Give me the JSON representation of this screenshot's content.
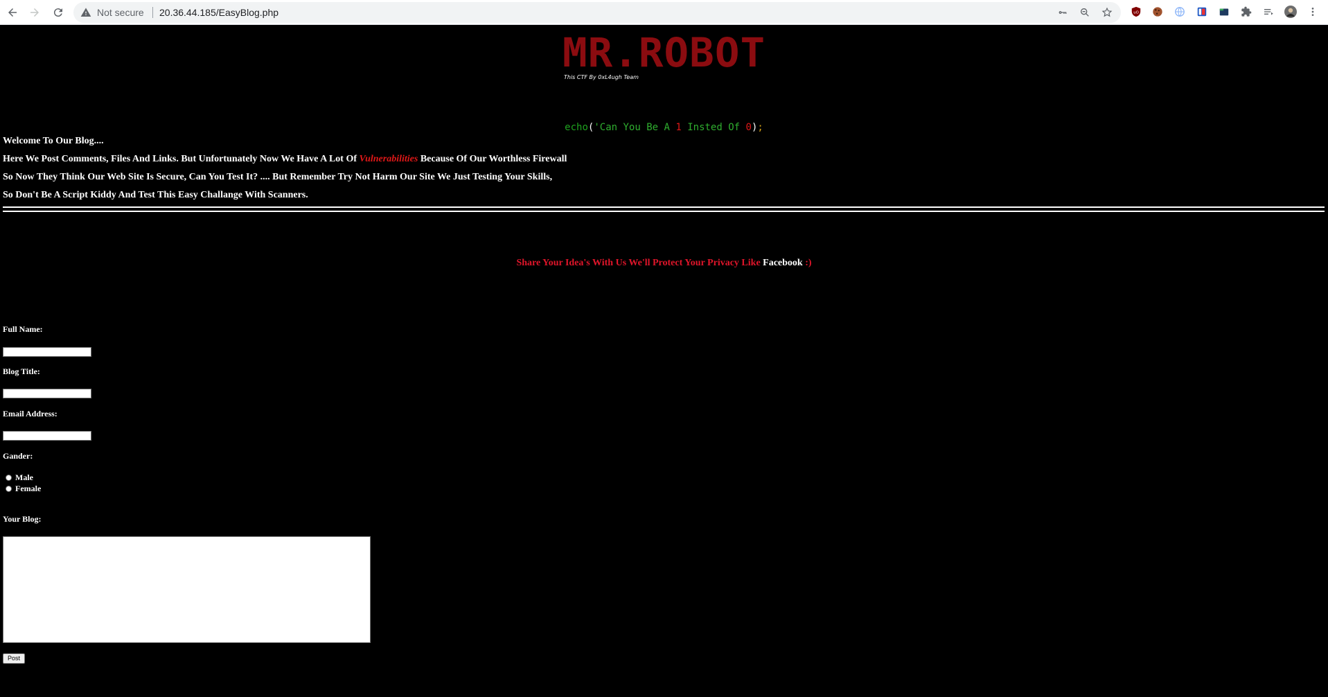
{
  "browser": {
    "security_label": "Not secure",
    "url": "20.36.44.185/EasyBlog.php"
  },
  "logo": {
    "title": "MR.ROBOT",
    "subtitle": "This CTF By 0xL4ugh Team",
    "color": "#8b0c10"
  },
  "echo_line": {
    "keyword": "echo",
    "open": "(",
    "quote_open": "'",
    "text_1": "Can You Be A ",
    "one": "1",
    "text_2": " Insted Of ",
    "zero": "0",
    "close": ")",
    "semicolon": ";"
  },
  "intro": {
    "line1": "Welcome To Our Blog....",
    "line2_pre": "Here We Post Comments, Files And Links. But Unfortunately Now We Have A Lot Of ",
    "line2_highlight": "Vulnerabilities",
    "line2_post": " Because Of Our Worthless Firewall",
    "line3": "So Now They Think Our Web Site Is Secure, Can You Test It? .... But Remember Try Not Harm Our Site We Just Testing Your Skills,",
    "line4": "So Don't Be A Script Kiddy And Test This Easy Challange With Scanners."
  },
  "share": {
    "text": "Share Your Idea's With Us We'll Protect Your Privacy Like ",
    "brand": "Facebook",
    "smile": " :)"
  },
  "form": {
    "full_name_label": "Full Name:",
    "full_name_value": "",
    "blog_title_label": "Blog Title:",
    "blog_title_value": "",
    "email_label": "Email Address:",
    "email_value": "",
    "gender_label": "Gander:",
    "gender_options": [
      "Male",
      "Female"
    ],
    "blog_label": "Your Blog:",
    "blog_value": "",
    "submit_label": "Post"
  },
  "colors": {
    "background": "#000000",
    "accent_red": "#e0152a",
    "code_green": "#1fa31f"
  }
}
